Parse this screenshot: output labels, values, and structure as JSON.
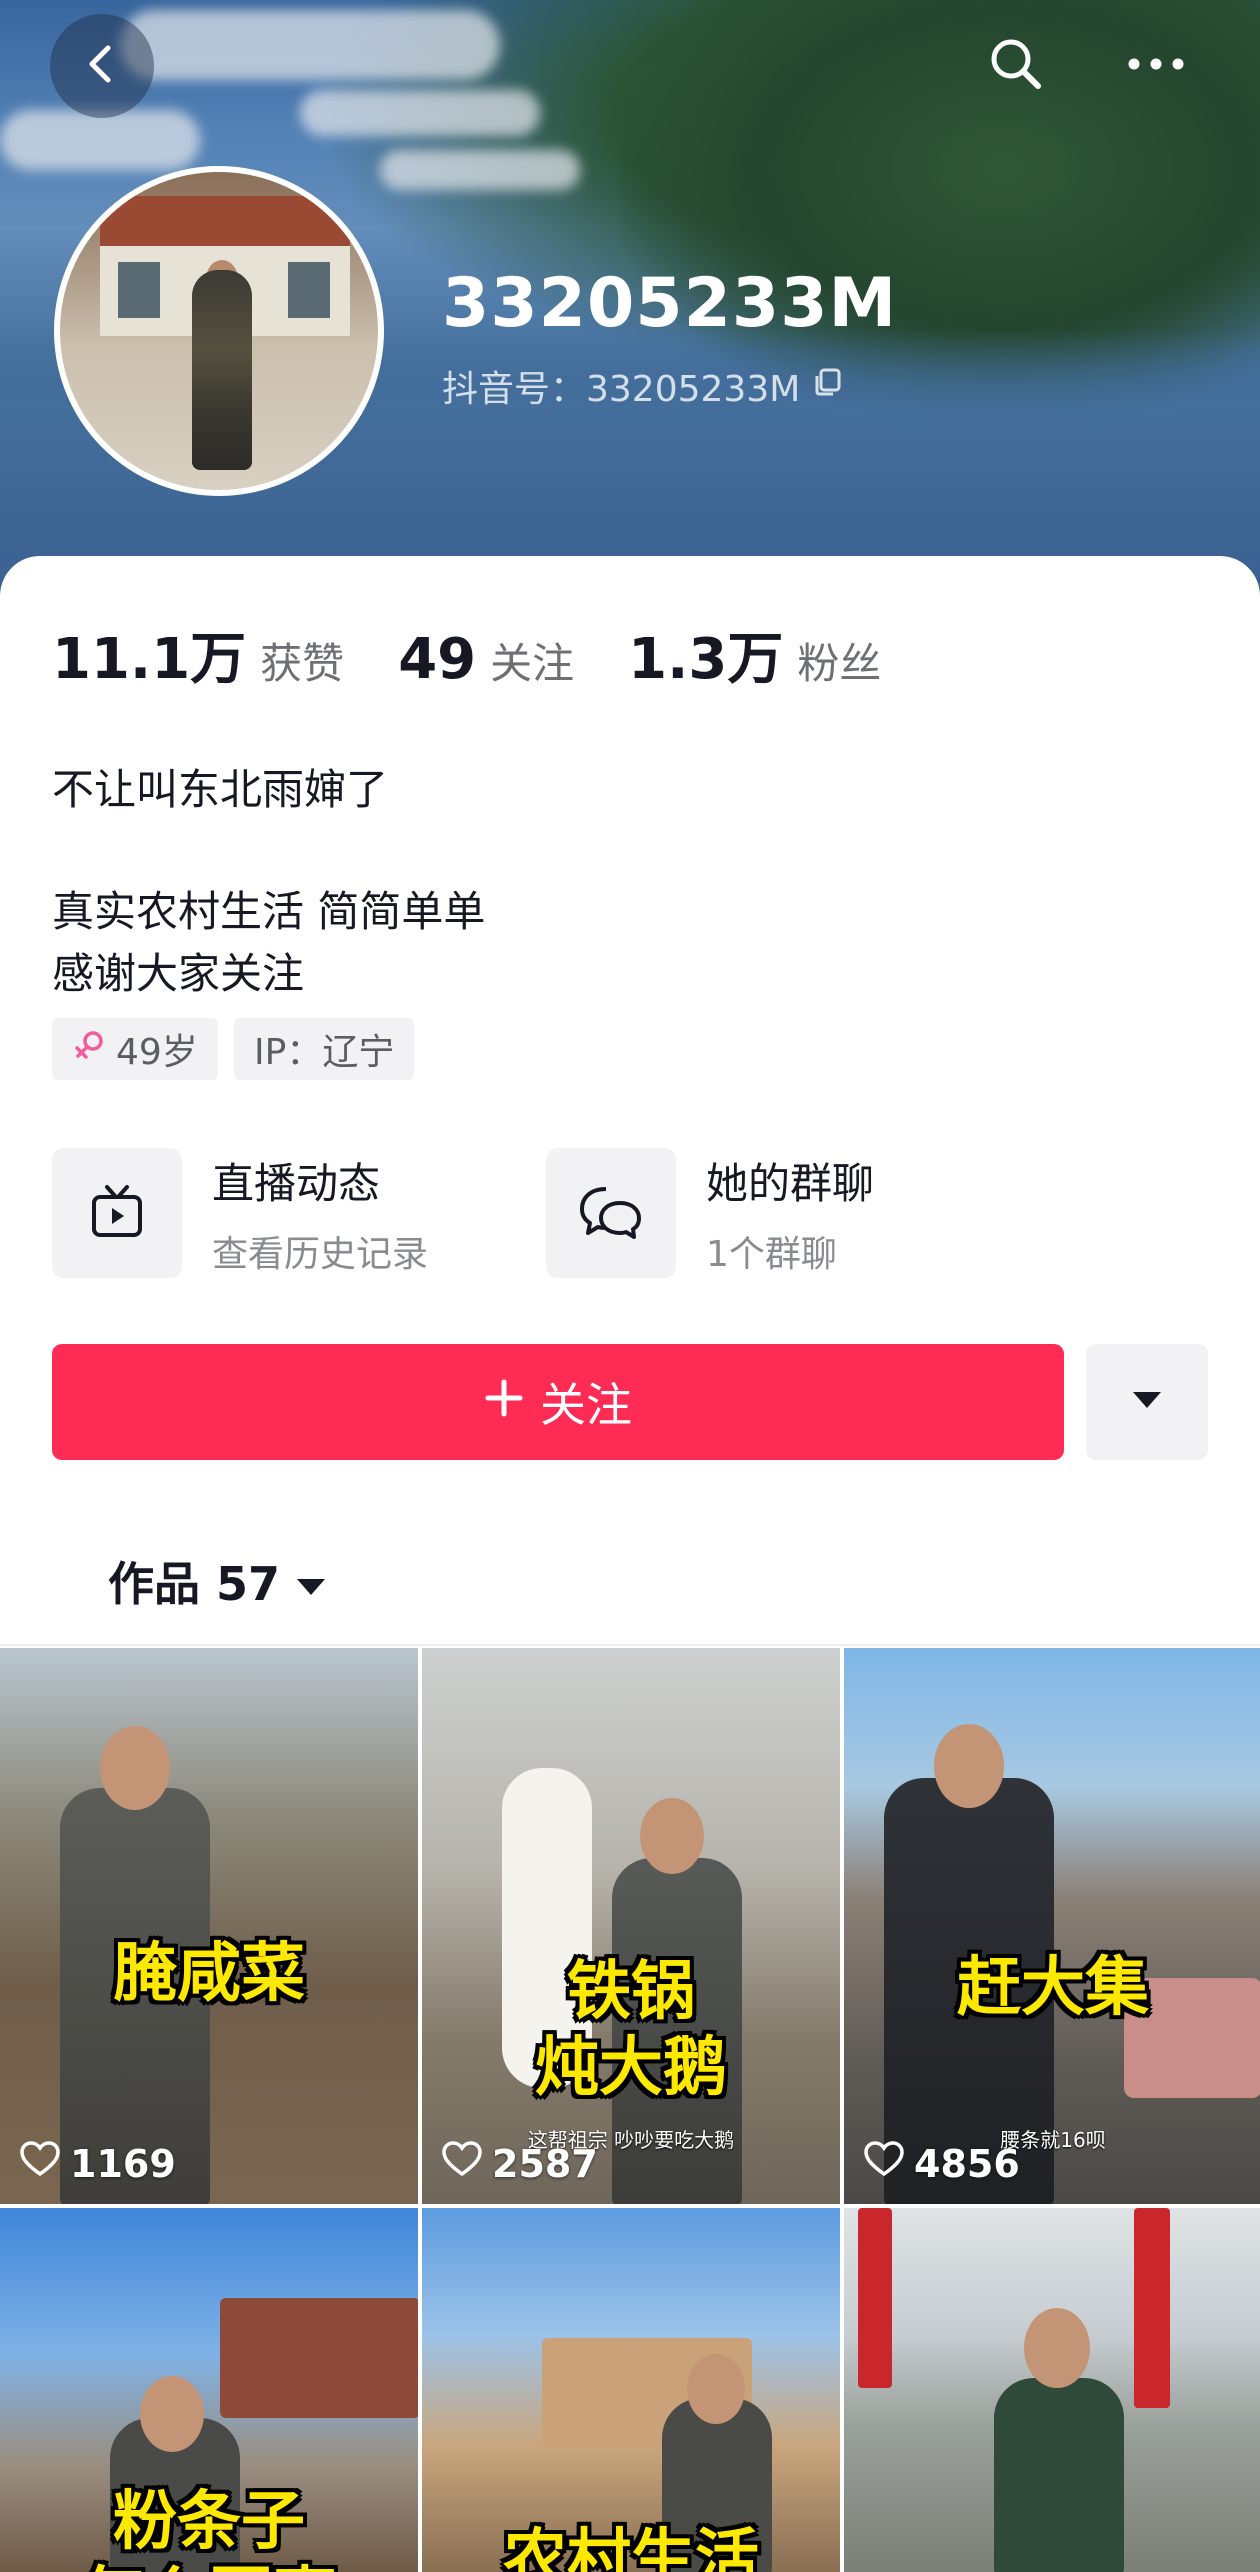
{
  "header": {
    "back_icon": "chevron-left-icon",
    "search_icon": "search-icon",
    "more_icon": "more-dots-icon"
  },
  "profile": {
    "name": "33205233M",
    "douyin_id": "抖音号：33205233M",
    "copy_icon": "copy-icon",
    "stats": [
      {
        "value": "11.1万",
        "label": "获赞"
      },
      {
        "value": "49",
        "label": "关注"
      },
      {
        "value": "1.3万",
        "label": "粉丝"
      }
    ],
    "bio": [
      "不让叫东北雨婶了",
      "真实农村生活 简简单单",
      "感谢大家关注"
    ],
    "tags": {
      "gender_age": "49岁",
      "ip": "IP：辽宁"
    }
  },
  "features": {
    "live": {
      "title": "直播动态",
      "subtitle": "查看历史记录",
      "icon": "tv-icon"
    },
    "group": {
      "title": "她的群聊",
      "subtitle": "1个群聊",
      "icon": "chat-bubbles-icon"
    }
  },
  "actions": {
    "follow": "关注",
    "follow_icon": "plus-icon",
    "more_icon": "caret-down-icon"
  },
  "works": {
    "label": "作品 57"
  },
  "videos": [
    {
      "caption": "腌咸菜",
      "likes": "1169",
      "subcaption": ""
    },
    {
      "caption": "铁锅\n炖大鹅",
      "likes": "2587",
      "subcaption": "这帮祖宗 吵吵要吃大鹅"
    },
    {
      "caption": "赶大集",
      "likes": "4856",
      "subcaption": "腰条就16呗"
    },
    {
      "caption": "粉条子\n怎么回事",
      "likes": "",
      "subcaption": ""
    },
    {
      "caption": "农村生活",
      "likes": "",
      "subcaption": ""
    },
    {
      "caption": "",
      "likes": "",
      "subcaption": ""
    }
  ],
  "colors": {
    "accent": "#fe2c55",
    "caption_yellow": "#fde800"
  }
}
